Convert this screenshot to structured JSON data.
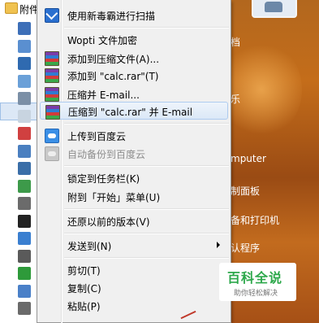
{
  "start_menu": {
    "folder_label": "附件",
    "left_icon_colors": [
      "#3d6fb8",
      "#5a8fd0",
      "#2f6ab0",
      "#6aa0d8",
      "#7b8fa6",
      "#c8d4e0",
      "#d04040",
      "#4a7fc0",
      "#3a6ea8",
      "#3d9a4a",
      "#6b6b6b",
      "#222222",
      "#3a7fd0",
      "#5a5a5a",
      "#2e9a3a",
      "#4a80c8",
      "#6a6a6a"
    ]
  },
  "desktop": {
    "labels": [
      "档",
      "乐",
      "mputer",
      "制面板",
      "备和打印机",
      "认程序"
    ],
    "user_picture_icon": "user-picture-icon"
  },
  "context_menu": {
    "items": [
      {
        "id": "scan",
        "label": "使用新毒霸进行扫描",
        "icon": "antivirus-icon",
        "disabled": false,
        "submenu": false
      },
      {
        "id": "wopti",
        "label": "Wopti 文件加密",
        "icon": "",
        "disabled": false,
        "submenu": false
      },
      {
        "id": "add-archive",
        "label": "添加到压缩文件(A)...",
        "icon": "rar-icon",
        "disabled": false,
        "submenu": false
      },
      {
        "id": "add-calc-rar",
        "label": "添加到 \"calc.rar\"(T)",
        "icon": "rar-icon",
        "disabled": false,
        "submenu": false
      },
      {
        "id": "compress-email",
        "label": "压缩并 E-mail...",
        "icon": "rar-icon",
        "disabled": false,
        "submenu": false
      },
      {
        "id": "compress-calc-email",
        "label": "压缩到 \"calc.rar\" 并 E-mail",
        "icon": "rar-icon",
        "disabled": false,
        "submenu": false,
        "hover": true
      },
      {
        "id": "upload-baidu",
        "label": "上传到百度云",
        "icon": "baidu-cloud-icon",
        "disabled": false,
        "submenu": false
      },
      {
        "id": "auto-backup",
        "label": "自动备份到百度云",
        "icon": "baidu-cloud-icon",
        "disabled": true,
        "submenu": false
      },
      {
        "id": "pin-taskbar",
        "label": "锁定到任务栏(K)",
        "icon": "",
        "disabled": false,
        "submenu": false
      },
      {
        "id": "pin-start",
        "label": "附到「开始」菜单(U)",
        "icon": "",
        "disabled": false,
        "submenu": false
      },
      {
        "id": "restore-prev",
        "label": "还原以前的版本(V)",
        "icon": "",
        "disabled": false,
        "submenu": false
      },
      {
        "id": "send-to",
        "label": "发送到(N)",
        "icon": "",
        "disabled": false,
        "submenu": true
      },
      {
        "id": "cut",
        "label": "剪切(T)",
        "icon": "",
        "disabled": false,
        "submenu": false
      },
      {
        "id": "copy",
        "label": "复制(C)",
        "icon": "",
        "disabled": false,
        "submenu": false
      },
      {
        "id": "paste",
        "label": "粘贴(P)",
        "icon": "",
        "disabled": false,
        "submenu": false
      }
    ]
  },
  "watermark": {
    "title": "百科全说",
    "subtitle": "助你轻松解决"
  }
}
